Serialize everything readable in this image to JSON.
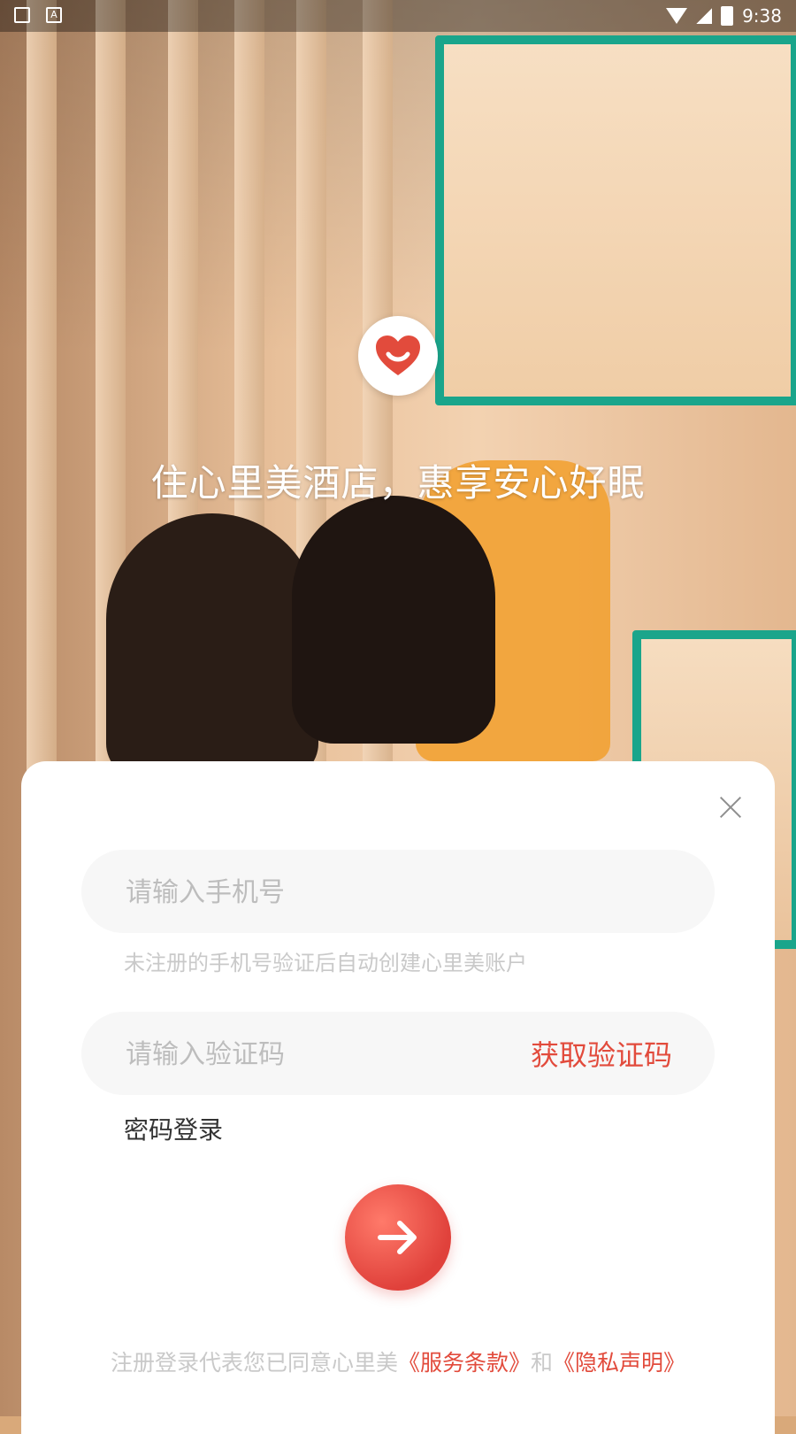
{
  "status_bar": {
    "time": "9:38",
    "icons": [
      "notification-icon",
      "keyboard-icon",
      "wifi-icon",
      "signal-icon",
      "battery-icon"
    ]
  },
  "hero": {
    "slogan": "住心里美酒店，惠享安心好眠",
    "logo_icon": "heart-logo"
  },
  "login": {
    "phone_placeholder": "请输入手机号",
    "phone_hint": "未注册的手机号验证后自动创建心里美账户",
    "code_placeholder": "请输入验证码",
    "get_code_label": "获取验证码",
    "password_login_label": "密码登录",
    "submit_icon": "arrow-right-icon",
    "close_icon": "close-icon"
  },
  "terms": {
    "prefix": "注册登录代表您已同意心里美",
    "service_link": "《服务条款》",
    "middle": "和",
    "privacy_link": "《隐私声明》"
  },
  "colors": {
    "accent": "#e24b3c",
    "hint_text": "#c9c9c9",
    "input_bg": "#f7f7f7"
  }
}
